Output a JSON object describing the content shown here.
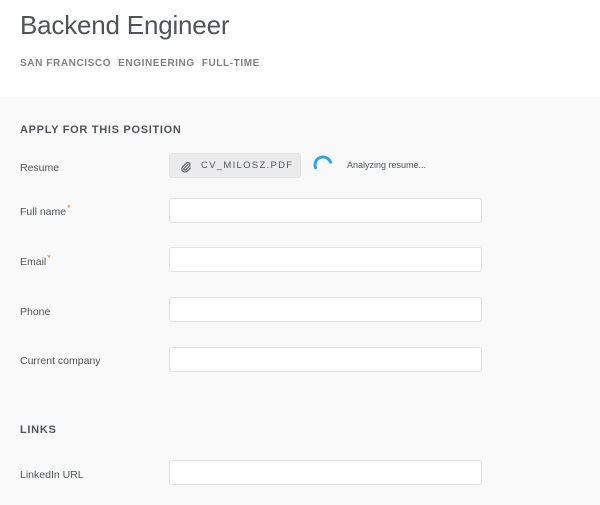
{
  "header": {
    "title": "Backend Engineer",
    "tags": [
      "SAN FRANCISCO",
      "ENGINEERING",
      "FULL-TIME"
    ]
  },
  "apply": {
    "section_title": "APPLY FOR THIS POSITION",
    "resume_label": "Resume",
    "resume_file": "CV_MILOSZ.PDF",
    "resume_status": "Analyzing resume...",
    "required_marker": "*",
    "fields": {
      "full_name": {
        "label": "Full name",
        "value": ""
      },
      "email": {
        "label": "Email",
        "value": ""
      },
      "phone": {
        "label": "Phone",
        "value": ""
      },
      "current_company": {
        "label": "Current company",
        "value": ""
      }
    }
  },
  "links": {
    "section_title": "LINKS",
    "linkedin": {
      "label": "LinkedIn URL",
      "value": ""
    }
  },
  "colors": {
    "required": "#e07a3f",
    "spinner": "#2fa6e0"
  },
  "icons": {
    "attach": "paperclip-icon",
    "loading": "spinner-icon"
  }
}
